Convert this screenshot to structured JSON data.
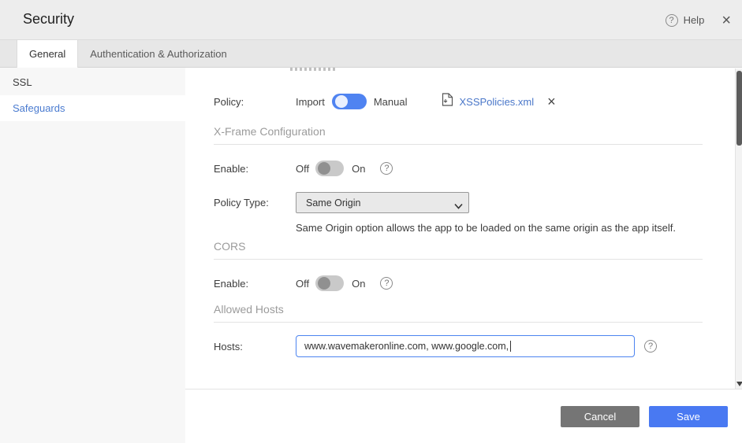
{
  "header": {
    "title": "Security",
    "help_label": "Help"
  },
  "tabs": [
    {
      "label": "General"
    },
    {
      "label": "Authentication & Authorization"
    }
  ],
  "sidebar": {
    "items": [
      {
        "label": "SSL"
      },
      {
        "label": "Safeguards"
      }
    ]
  },
  "main": {
    "policy": {
      "label": "Policy:",
      "option_left": "Import",
      "option_right": "Manual",
      "file_name": "XSSPolicies.xml"
    },
    "xframe": {
      "heading": "X-Frame Configuration",
      "enable_label": "Enable:",
      "off": "Off",
      "on": "On",
      "policy_type_label": "Policy Type:",
      "policy_type_value": "Same Origin",
      "policy_type_help": "Same Origin option allows the app to be loaded on the same origin as the app itself."
    },
    "cors": {
      "heading": "CORS",
      "enable_label": "Enable:",
      "off": "Off",
      "on": "On"
    },
    "allowed_hosts": {
      "heading": "Allowed Hosts",
      "hosts_label": "Hosts:",
      "hosts_value": "www.wavemakeronline.com, www.google.com, "
    }
  },
  "footer": {
    "cancel_label": "Cancel",
    "save_label": "Save"
  },
  "colors": {
    "accent": "#4979f2",
    "link": "#4a77c9",
    "toggle_on": "#4f83f1",
    "toggle_off_track": "#c9c9c9",
    "toggle_off_knob": "#909090",
    "selected_nav": "#4a7bd0"
  }
}
